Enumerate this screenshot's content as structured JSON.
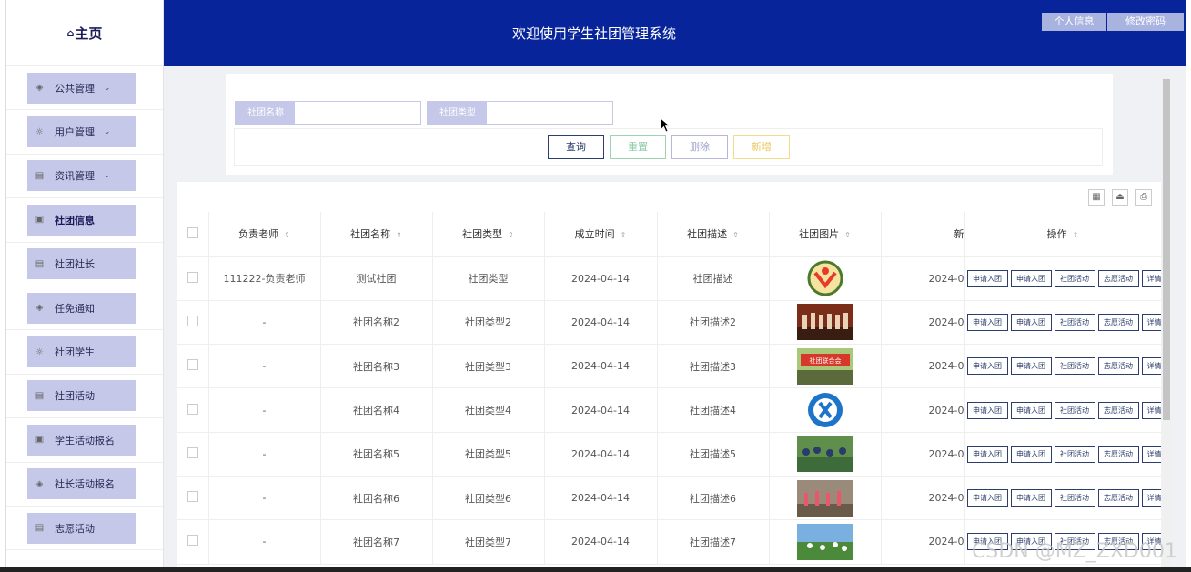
{
  "brand": {
    "home_icon": "⌂",
    "title": "主页"
  },
  "sidebar": {
    "items": [
      {
        "label": "公共管理",
        "icon": "layers-icon",
        "expandable": true
      },
      {
        "label": "用户管理",
        "icon": "bulb-icon",
        "expandable": true
      },
      {
        "label": "资讯管理",
        "icon": "grid-icon",
        "expandable": true
      },
      {
        "label": "社团信息",
        "icon": "clipboard-icon",
        "expandable": false,
        "active": true
      },
      {
        "label": "社团社长",
        "icon": "grid-icon",
        "expandable": false
      },
      {
        "label": "任免通知",
        "icon": "layers-icon",
        "expandable": false
      },
      {
        "label": "社团学生",
        "icon": "bulb-icon",
        "expandable": false
      },
      {
        "label": "社团活动",
        "icon": "grid-icon",
        "expandable": false
      },
      {
        "label": "学生活动报名",
        "icon": "clipboard-icon",
        "expandable": false
      },
      {
        "label": "社长活动报名",
        "icon": "layers-icon",
        "expandable": false
      },
      {
        "label": "志愿活动",
        "icon": "grid-icon",
        "expandable": false
      }
    ]
  },
  "header": {
    "title": "欢迎使用学生社团管理系统",
    "profile_label": "个人信息",
    "password_label": "修改密码"
  },
  "search": {
    "club_name_label": "社团名称",
    "club_type_label": "社团类型",
    "club_name_value": "",
    "club_type_value": "",
    "query_label": "查询",
    "reset_label": "重置",
    "delete_label": "删除",
    "add_label": "新增"
  },
  "table": {
    "headers": [
      "负责老师",
      "社团名称",
      "社团类型",
      "成立时间",
      "社团描述",
      "社团图片",
      "新",
      "操作"
    ],
    "op_labels": [
      "申请入团",
      "申请入团",
      "社团活动",
      "志愿活动",
      "详情"
    ],
    "rows": [
      {
        "teacher": "111222-负责老师",
        "name": "测试社团",
        "type": "社团类型",
        "date": "2024-04-14",
        "desc": "社团描述",
        "img": "logo",
        "extra": "2024-0"
      },
      {
        "teacher": "-",
        "name": "社团名称2",
        "type": "社团类型2",
        "date": "2024-04-14",
        "desc": "社团描述2",
        "img": "stage",
        "extra": "2024-0"
      },
      {
        "teacher": "-",
        "name": "社团名称3",
        "type": "社团类型3",
        "date": "2024-04-14",
        "desc": "社团描述3",
        "img": "banner",
        "extra": "2024-0"
      },
      {
        "teacher": "-",
        "name": "社团名称4",
        "type": "社团类型4",
        "date": "2024-04-14",
        "desc": "社团描述4",
        "img": "badge",
        "extra": "2024-0"
      },
      {
        "teacher": "-",
        "name": "社团名称5",
        "type": "社团类型5",
        "date": "2024-04-14",
        "desc": "社团描述5",
        "img": "crowd",
        "extra": "2024-0"
      },
      {
        "teacher": "-",
        "name": "社团名称6",
        "type": "社团类型6",
        "date": "2024-04-14",
        "desc": "社团描述6",
        "img": "dance",
        "extra": "2024-0"
      },
      {
        "teacher": "-",
        "name": "社团名称7",
        "type": "社团类型7",
        "date": "2024-04-14",
        "desc": "社团描述7",
        "img": "field",
        "extra": "2024-0"
      }
    ]
  },
  "colors": {
    "header_bg": "#08249a",
    "menu_bg": "#c5c8e8",
    "op_border": "#2c3e6b"
  },
  "watermark": "CSDN @MZ_ZXD001"
}
